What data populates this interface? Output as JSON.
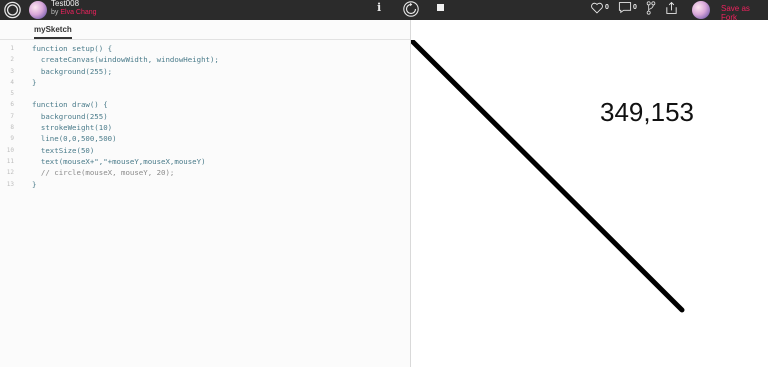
{
  "header": {
    "sketch_title": "Test008",
    "by": "by",
    "author": "Elva Chang",
    "heart_count": "0",
    "comment_count": "0",
    "save_fork_label": "Save as Fork",
    "accent_color": "#ed225d",
    "icons": [
      "p5-logo-icon",
      "avatar",
      "info-icon",
      "replay-icon",
      "stop-icon",
      "heart-icon",
      "comment-icon",
      "fork-icon",
      "share-icon"
    ]
  },
  "editor": {
    "tab_label": "mySketch",
    "lines": [
      {
        "n": "1",
        "code": "function setup() {"
      },
      {
        "n": "2",
        "code": "  createCanvas(windowWidth, windowHeight);"
      },
      {
        "n": "3",
        "code": "  background(255);"
      },
      {
        "n": "4",
        "code": "}"
      },
      {
        "n": "5",
        "code": ""
      },
      {
        "n": "6",
        "code": "function draw() {"
      },
      {
        "n": "7",
        "code": "  background(255)"
      },
      {
        "n": "8",
        "code": "  strokeWeight(10)"
      },
      {
        "n": "9",
        "code": "  line(0,0,500,500)"
      },
      {
        "n": "10",
        "code": "  textSize(50)"
      },
      {
        "n": "11",
        "code": "  text(mouseX+\",\"+mouseY,mouseX,mouseY)"
      },
      {
        "n": "12",
        "code": "  // circle(mouseX, mouseY, 20);"
      },
      {
        "n": "13",
        "code": "}"
      }
    ]
  },
  "canvas": {
    "coordinate_text": "349,153"
  }
}
